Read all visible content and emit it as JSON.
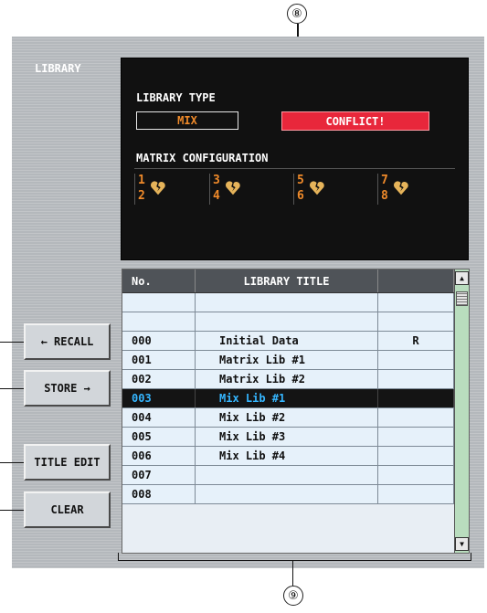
{
  "callouts": {
    "top": "⑧",
    "bottom": "⑨"
  },
  "panel": {
    "label": "LIBRARY"
  },
  "library_type": {
    "title": "LIBRARY TYPE",
    "current": "MIX",
    "status": "CONFLICT!"
  },
  "matrix_config": {
    "title": "MATRIX CONFIGURATION",
    "pairs": [
      {
        "a": "1",
        "b": "2",
        "icon": "broken-heart-icon"
      },
      {
        "a": "3",
        "b": "4",
        "icon": "broken-heart-icon"
      },
      {
        "a": "5",
        "b": "6",
        "icon": "broken-heart-icon"
      },
      {
        "a": "7",
        "b": "8",
        "icon": "broken-heart-icon"
      }
    ]
  },
  "buttons": {
    "recall": "← RECALL",
    "store": "STORE →",
    "title_edit": "TITLE EDIT",
    "clear": "CLEAR"
  },
  "table": {
    "headers": {
      "no": "No.",
      "title": "LIBRARY TITLE",
      "flag": ""
    },
    "rows": [
      {
        "no": "",
        "title": "",
        "flag": ""
      },
      {
        "no": "",
        "title": "",
        "flag": ""
      },
      {
        "no": "000",
        "title": "Initial Data",
        "flag": "R"
      },
      {
        "no": "001",
        "title": "Matrix Lib #1",
        "flag": ""
      },
      {
        "no": "002",
        "title": "Matrix Lib #2",
        "flag": ""
      },
      {
        "no": "003",
        "title": "Mix Lib #1",
        "flag": "",
        "selected": true
      },
      {
        "no": "004",
        "title": "Mix Lib #2",
        "flag": ""
      },
      {
        "no": "005",
        "title": "Mix Lib #3",
        "flag": ""
      },
      {
        "no": "006",
        "title": "Mix Lib #4",
        "flag": ""
      },
      {
        "no": "007",
        "title": "",
        "flag": ""
      },
      {
        "no": "008",
        "title": "",
        "flag": ""
      }
    ]
  },
  "colors": {
    "conflict": "#e8273b",
    "orange": "#ef8a2a",
    "selected_text": "#35b6ff",
    "row_bg": "#e6f1fa"
  }
}
